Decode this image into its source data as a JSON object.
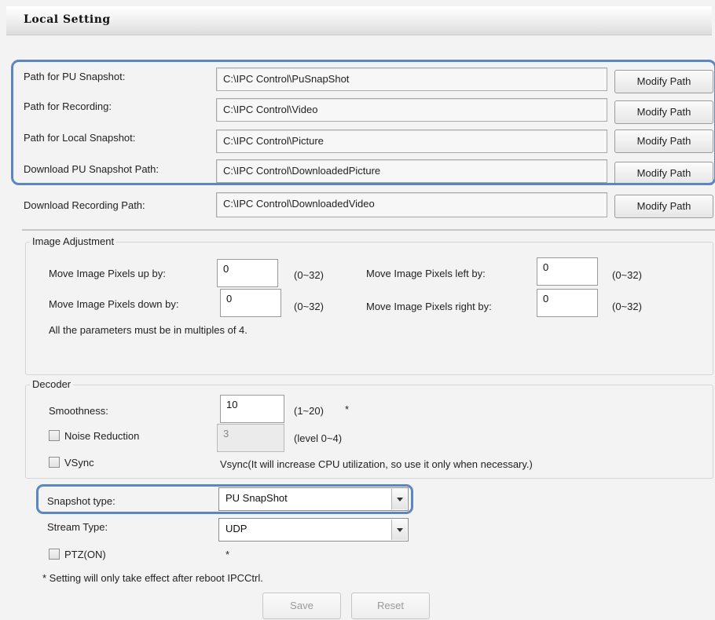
{
  "window": {
    "title": "Local Setting"
  },
  "paths": [
    {
      "label": "Path for PU Snapshot:",
      "value": "C:\\IPC Control\\PuSnapShot",
      "button": "Modify Path"
    },
    {
      "label": "Path for Recording:",
      "value": "C:\\IPC Control\\Video",
      "button": "Modify Path"
    },
    {
      "label": "Path for Local Snapshot:",
      "value": "C:\\IPC Control\\Picture",
      "button": "Modify Path"
    },
    {
      "label": "Download PU Snapshot Path:",
      "value": "C:\\IPC Control\\DownloadedPicture",
      "button": "Modify Path"
    },
    {
      "label": "Download Recording Path:",
      "value": "C:\\IPC Control\\DownloadedVideo",
      "button": "Modify Path"
    }
  ],
  "image_adjustment": {
    "legend": "Image Adjustment",
    "up": {
      "label": "Move Image Pixels up by:",
      "value": "0",
      "range": "(0~32)"
    },
    "down": {
      "label": "Move Image Pixels down by:",
      "value": "0",
      "range": "(0~32)"
    },
    "left": {
      "label": "Move Image Pixels left by:",
      "value": "0",
      "range": "(0~32)"
    },
    "right": {
      "label": "Move Image Pixels right by:",
      "value": "0",
      "range": "(0~32)"
    },
    "note": "All the parameters must be in multiples of 4."
  },
  "decoder": {
    "legend": "Decoder",
    "smoothness": {
      "label": "Smoothness:",
      "value": "10",
      "range": "(1~20)",
      "mark": "*"
    },
    "noise_reduction": {
      "label": "Noise Reduction",
      "checked": false,
      "value": "3",
      "range": "(level 0~4)"
    },
    "vsync": {
      "label": "VSync",
      "checked": false,
      "note": "Vsync(It will increase CPU utilization, so use it only when necessary.)"
    }
  },
  "stream": {
    "snapshot_type": {
      "label": "Snapshot type:",
      "value": "PU SnapShot"
    },
    "stream_type": {
      "label": "Stream Type:",
      "value": "UDP"
    },
    "ptz": {
      "label": "PTZ(ON)",
      "checked": false,
      "mark": "*"
    },
    "footnote": "* Setting will only take effect after reboot IPCCtrl."
  },
  "actions": {
    "save": "Save",
    "reset": "Reset"
  },
  "colors": {
    "highlight": "#5b86c0",
    "background": "#f3f3f3"
  }
}
